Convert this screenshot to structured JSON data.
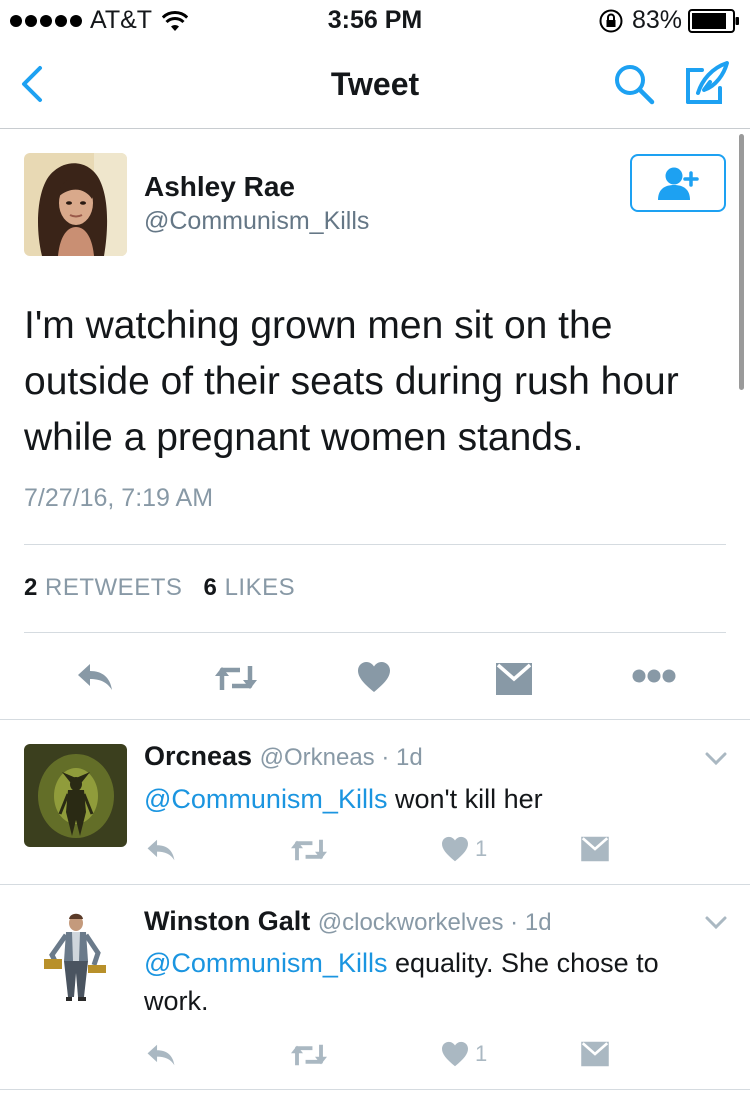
{
  "status_bar": {
    "carrier": "AT&T",
    "time": "3:56 PM",
    "battery": "83%"
  },
  "nav": {
    "title": "Tweet"
  },
  "tweet": {
    "author_name": "Ashley Rae",
    "author_handle": "@Communism_Kills",
    "text": "I'm watching grown men sit on the outside of their seats during rush hour while a pregnant women stands.",
    "timestamp": "7/27/16, 7:19 AM",
    "retweet_count": "2",
    "retweet_label": "RETWEETS",
    "like_count": "6",
    "like_label": "LIKES"
  },
  "replies": [
    {
      "name": "Orcneas",
      "handle": "@Orkneas",
      "time": "1d",
      "mention": "@Communism_Kills",
      "text": "won't kill her",
      "like_count": "1"
    },
    {
      "name": "Winston Galt",
      "handle": "@clockworkelves",
      "time": "1d",
      "mention": "@Communism_Kills",
      "text": "equality. She chose to work.",
      "like_count": "1"
    }
  ],
  "colors": {
    "accent": "#1da1f2",
    "mention": "#1b95e0",
    "action_gray": "#8899a6",
    "light_gray": "#aab8c2"
  }
}
